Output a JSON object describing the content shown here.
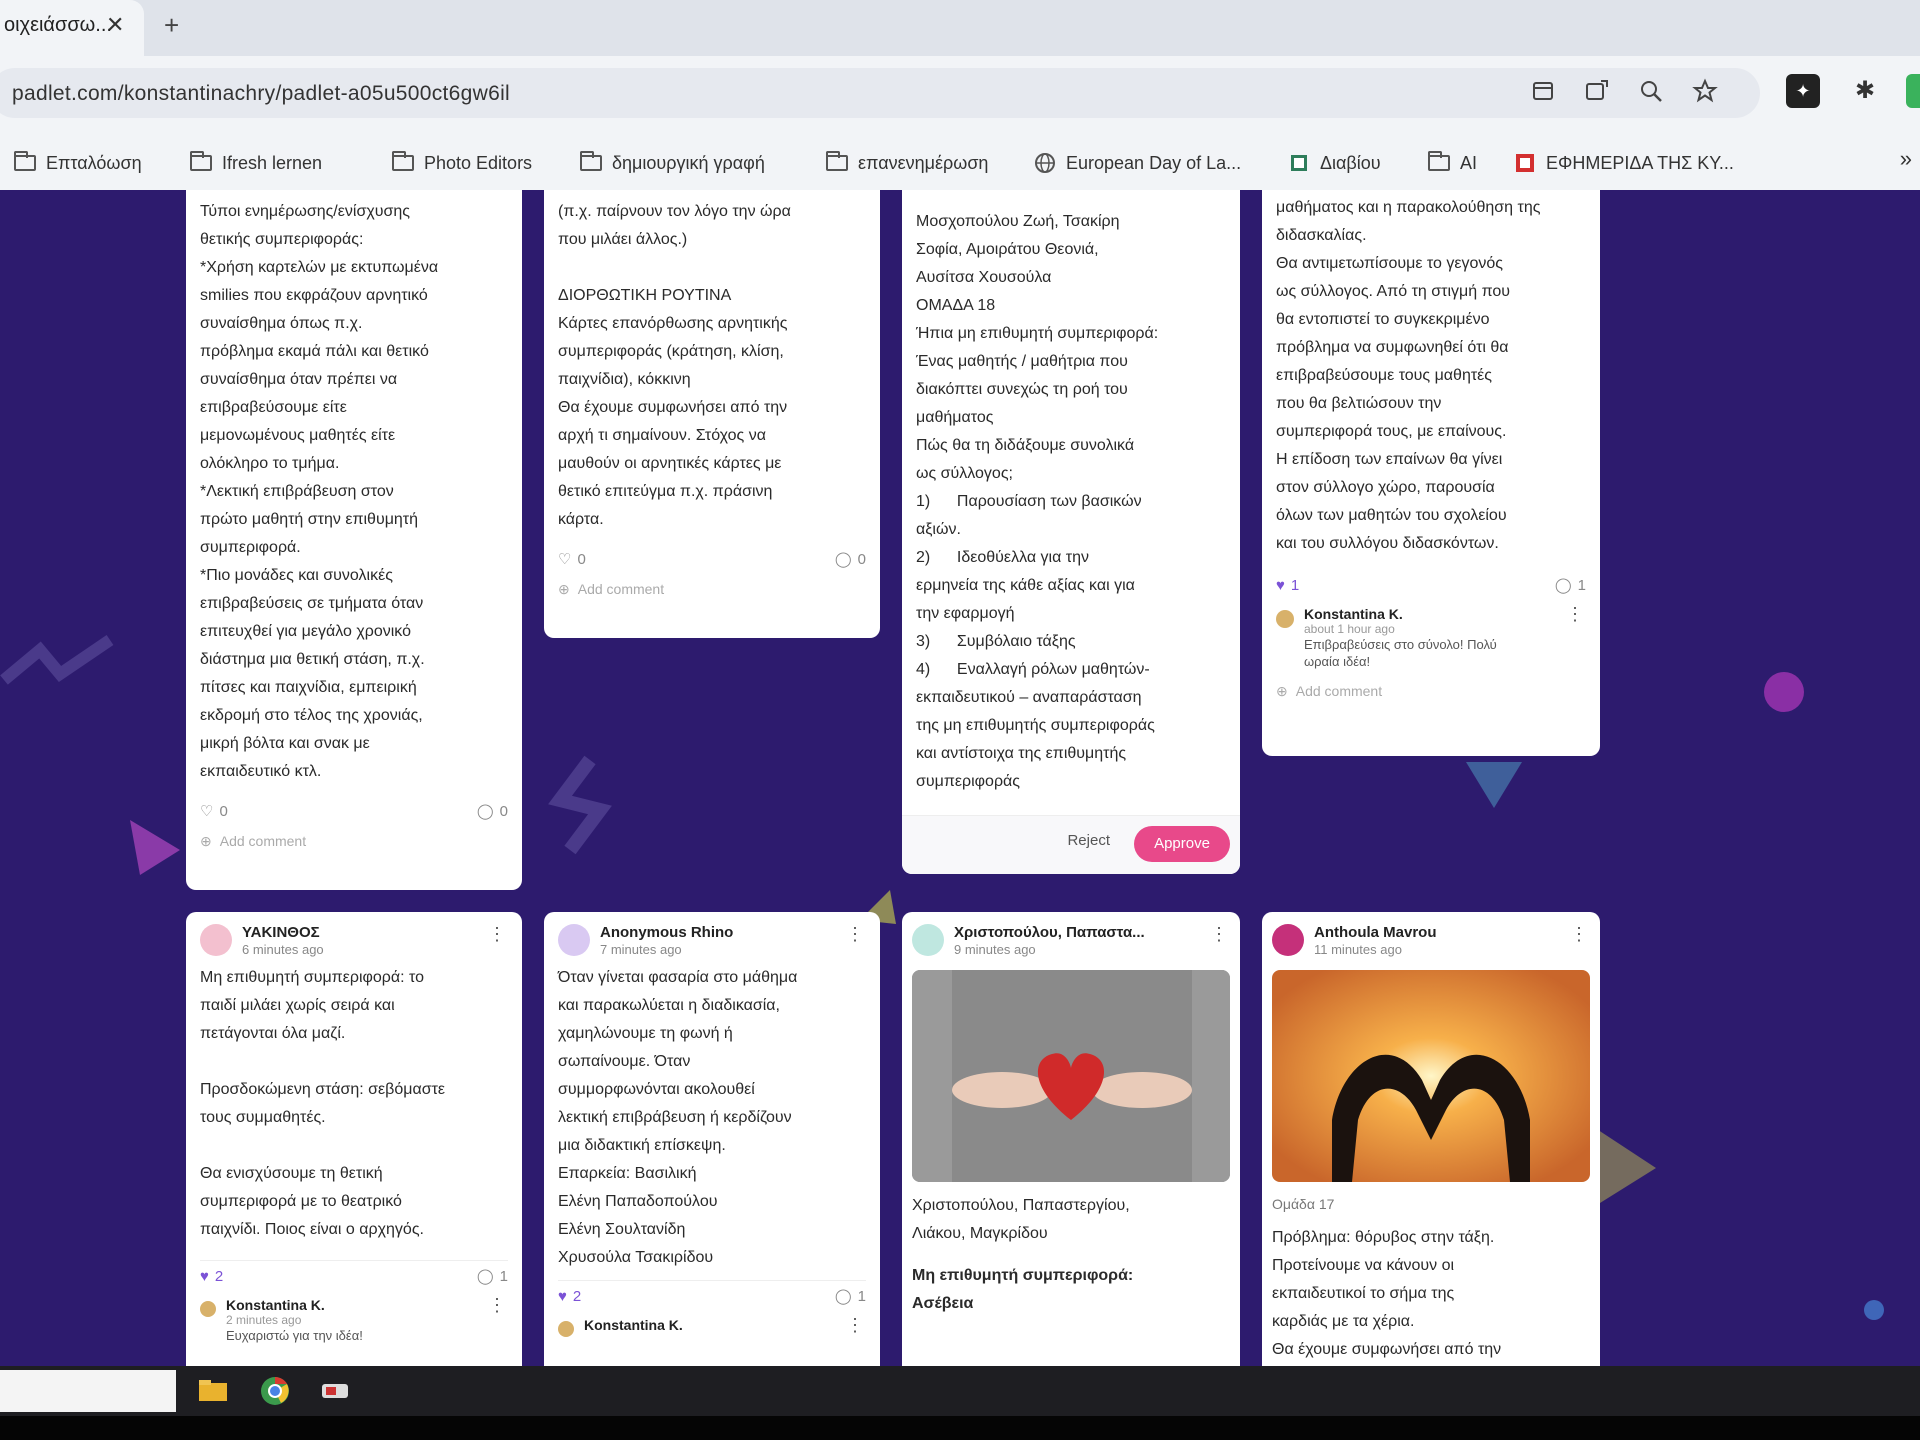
{
  "browser": {
    "tab_title": "οιχειάσσω...",
    "tab_close": "✕",
    "tab_new": "+",
    "url": "padlet.com/konstantinachry/padlet-a05u500ct6gw6il",
    "bookmarks": [
      {
        "label": "Επταλόωση",
        "icon": "folder-icon"
      },
      {
        "label": "Ifresh lernen",
        "icon": "folder-icon"
      },
      {
        "label": "Photo Editors",
        "icon": "folder-icon"
      },
      {
        "label": "δημιουργική γραφή",
        "icon": "folder-icon"
      },
      {
        "label": "επανενημέρωση",
        "icon": "folder-icon"
      },
      {
        "label": "European Day of La...",
        "icon": "globe-icon"
      },
      {
        "label": "Διαβίου",
        "icon": "book-icon"
      },
      {
        "label": "AI",
        "icon": "folder-icon"
      },
      {
        "label": "ΕΦΗΜΕΡΙΔΑ ΤΗΣ ΚΥ...",
        "icon": "news-icon"
      }
    ],
    "bookmarks_more": "»"
  },
  "cards": {
    "c1": {
      "body": "Τύποι ενημέρωσης/ενίσχυσης\nθετικής συμπεριφοράς:\n*Χρήση καρτελών με εκτυπωμένα\nsmilies που εκφράζουν αρνητικό\nσυναίσθημα όπως π.χ.\nπρόβλημα εκαμά πάλι και θετικό\nσυναίσθημα όταν πρέπει να\nεπιβραβεύσουμε είτε\nμεμονωμένους μαθητές είτε\nολόκληρο το τμήμα.\n*Λεκτική επιβράβευση στον\nπρώτο μαθητή στην επιθυμητή\nσυμπεριφορά.\n*Πιο μονάδες και συνολικές\nεπιβραβεύσεις σε τμήματα όταν\nεπιτευχθεί για μεγάλο χρονικό\nδιάστημα μια θετική στάση, π.χ.\nπίτσες και παιχνίδια, εμπειρική\nεκδρομή στο τέλος της χρονιάς,\nμικρή βόλτα και σνακ με\nεκπαιδευτικό κτλ.",
      "likes": "0",
      "comments": "0",
      "add_comment": "Add comment"
    },
    "c2": {
      "body": "(π.χ. παίρνουν τον λόγο την ώρα\nπου μιλάει άλλος.)\n\nΔΙΟΡΘΩΤΙΚΗ ΡΟΥΤΙΝΑ\nΚάρτες επανόρθωσης αρνητικής\nσυμπεριφοράς (κράτηση, κλίση,\nπαιχνίδια), κόκκινη\nΘα έχουμε συμφωνήσει από την\nαρχή τι σημαίνουν. Στόχος να\nμαυθούν οι αρνητικές κάρτες με\nθετικό επιτεύγμα π.χ. πράσινη\nκάρτα.",
      "likes": "0",
      "comments": "0",
      "add_comment": "Add comment"
    },
    "c3": {
      "body": "Μοσχοπούλου Ζωή, Τσακίρη\nΣοφία, Αμοιράτου Θεονιά,\nΑυσίτσα Χουσούλα\nΟΜΑΔΑ 18\nΉπια μη επιθυμητή συμπεριφορά:\nΈνας μαθητής / μαθήτρια που\nδιακόπτει συνεχώς τη ροή του\nμαθήματος\nΠώς θα τη διδάξουμε συνολικά\nως σύλλογος;\n1)      Παρουσίαση των βασικών\nαξιών.\n2)      Ιδεοθύελλα για την\nερμηνεία της κάθε αξίας και για\nτην εφαρμογή\n3)      Συμβόλαιο τάξης\n4)      Εναλλαγή ρόλων μαθητών-\nεκπαιδευτικού – αναπαράσταση\nτης μη επιθυμητής συμπεριφοράς\nκαι αντίστοιχα της επιθυμητής\nσυμπεριφοράς",
      "reject": "Reject",
      "approve": "Approve"
    },
    "c4": {
      "body": "μαθήματος και η παρακολούθηση της\nδιδασκαλίας.\nΘα αντιμετωπίσουμε το γεγονός\nως σύλλογος. Από τη στιγμή που\nθα εντοπιστεί το συγκεκριμένο\nπρόβλημα να συμφωνηθεί ότι θα\nεπιβραβεύσουμε τους μαθητές\nπου θα βελτιώσουν την\nσυμπεριφορά τους, με επαίνους.\nΗ επίδοση των επαίνων θα γίνει\nστον σύλλογο χώρο, παρουσία\nόλων των μαθητών του σχολείου\nκαι του συλλόγου διδασκόντων.",
      "likes": "1",
      "comments": "1",
      "comment_author": "Konstantina K.",
      "comment_time": "about 1 hour ago",
      "comment_text": "Επιβραβεύσεις στο σύνολο! Πολύ\nωραία ιδέα!",
      "add_comment": "Add comment"
    },
    "c5": {
      "author": "ΥΑΚΙΝΘΟΣ",
      "time": "6 minutes ago",
      "body": "Μη επιθυμητή συμπεριφορά: το\nπαιδί μιλάει χωρίς σειρά και\nπετάγονται όλα μαζί.\n\nΠροσδοκώμενη στάση: σεβόμαστε\nτους συμμαθητές.\n\nΘα ενισχύσουμε τη θετική\nσυμπεριφορά με το θεατρικό\nπαιχνίδι. Ποιος είναι ο αρχηγός.",
      "likes": "2",
      "comments": "1",
      "comment_author": "Konstantina K.",
      "comment_time": "2 minutes ago",
      "comment_text": "Ευχαριστώ για την ιδέα!"
    },
    "c6": {
      "author": "Anonymous Rhino",
      "time": "7 minutes ago",
      "body": "Όταν γίνεται φασαρία στο μάθημα\nκαι παρακωλύεται η διαδικασία,\nχαμηλώνουμε τη φωνή ή\nσωπαίνουμε. Όταν\nσυμμορφωνόνται ακολουθεί\nλεκτική επιβράβευση ή κερδίζουν\nμια διδακτική επίσκεψη.\nΕπαρκεία: Βασιλική\nΕλένη Παπαδοπούλου\nΕλένη Σουλτανίδη\nΧρυσούλα Τσακιρίδου",
      "likes": "2",
      "comments": "1",
      "comment_author": "Konstantina K."
    },
    "c7": {
      "author": "Χριστοπούλου, Παπαστα...",
      "time": "9 minutes ago",
      "caption": "Χριστοπούλου, Παπαστεργίου,\nΛιάκου, Μαγκρίδου",
      "body": "Μη επιθυμητή συμπεριφορά:\nΑσέβεια"
    },
    "c8": {
      "author": "Anthoula Mavrou",
      "time": "11 minutes ago",
      "group": "Ομάδα 17",
      "body": "Πρόβλημα: θόρυβος στην τάξη.\nΠροτείνουμε να κάνουν οι\nεκπαιδευτικοί το σήμα της\nκαρδιάς με τα χέρια.\nΘα έχουμε συμφωνήσει από την"
    }
  },
  "colors": {
    "board_bg": "#2d1b6e",
    "accent_pink": "#e8498a",
    "heart_purple": "#7b52d6"
  }
}
